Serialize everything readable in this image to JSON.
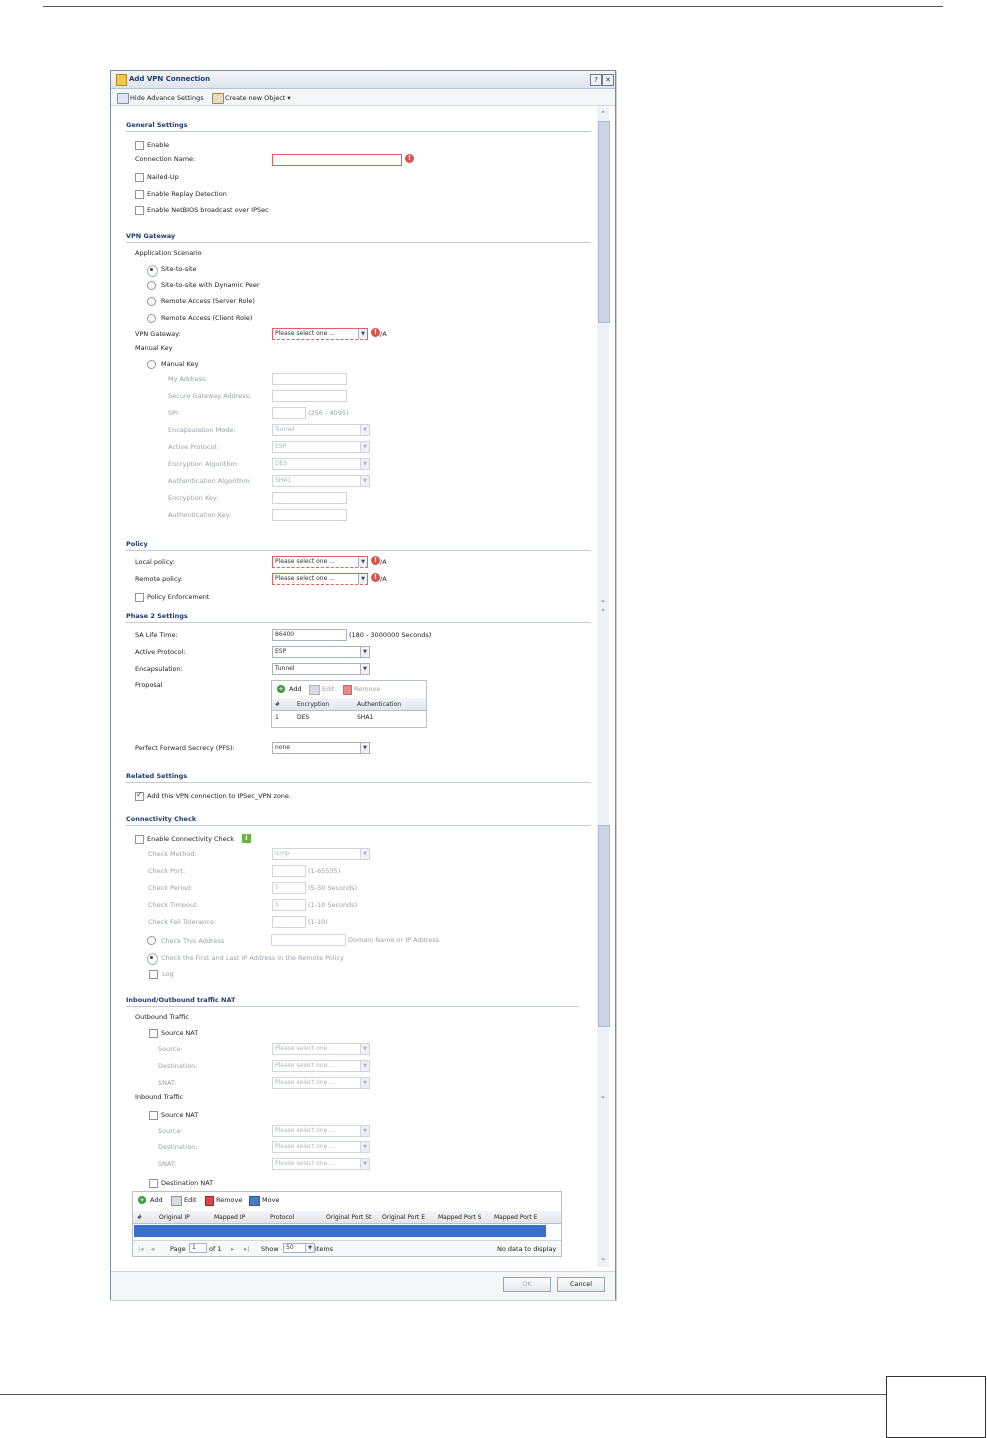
{
  "dialog": {
    "title": "Add VPN Connection",
    "help_glyph": "?",
    "close_glyph": "✕",
    "toolbar": {
      "hide_advanced": "Hide Advance Settings",
      "create_object": "Create new Object ▾"
    }
  },
  "general": {
    "title": "General Settings",
    "enable": "Enable",
    "connection_name_label": "Connection Name:",
    "connection_name_value": "",
    "nailed_up": "Nailed-Up",
    "replay_detection": "Enable Replay Detection",
    "netbios": "Enable NetBIOS broadcast over IPSec"
  },
  "gateway": {
    "title": "VPN Gateway",
    "scenario_label": "Application Scenario",
    "scenarios": [
      "Site-to-site",
      "Site-to-site with Dynamic Peer",
      "Remote Access (Server Role)",
      "Remote Access (Client Role)"
    ],
    "gateway_label": "VPN Gateway:",
    "gateway_value": "Please select one ...",
    "na": "/A",
    "manual_key_heading": "Manual Key",
    "manual_key_radio": "Manual Key",
    "my_address": "My Address:",
    "secure_gateway": "Secure Gateway Address:",
    "spi": "SPI:",
    "spi_range": "(256 - 4095)",
    "encap_mode": "Encapsulation Mode:",
    "encap_mode_value": "Tunnel",
    "active_protocol": "Active Protocol:",
    "active_protocol_value": "ESP",
    "enc_algo": "Encryption Algorithm:",
    "enc_algo_value": "DES",
    "auth_algo": "Authentication Algorithm:",
    "auth_algo_value": "SHA1",
    "enc_key": "Encryption Key:",
    "auth_key": "Authentication Key:"
  },
  "policy": {
    "title": "Policy",
    "local_label": "Local policy:",
    "local_value": "Please select one ...",
    "remote_label": "Remote policy:",
    "remote_value": "Please select one ...",
    "na": "/A",
    "enforcement": "Policy Enforcement"
  },
  "phase2": {
    "title": "Phase 2 Settings",
    "sa_life_label": "SA Life Time:",
    "sa_life_value": "86400",
    "sa_life_range": "(180 - 3000000 Seconds)",
    "active_protocol_label": "Active Protocol:",
    "active_protocol_value": "ESP",
    "encapsulation_label": "Encapsulation:",
    "encapsulation_value": "Tunnel",
    "proposal_label": "Proposal",
    "add": "Add",
    "edit": "Edit",
    "remove": "Remove",
    "columns": [
      "#",
      "Encryption",
      "Authentication"
    ],
    "rows": [
      [
        "1",
        "DES",
        "SHA1"
      ]
    ],
    "pfs_label": "Perfect Forward Secrecy (PFS):",
    "pfs_value": "none"
  },
  "related": {
    "title": "Related Settings",
    "add_zone": "Add this VPN connection to IPSec_VPN zone."
  },
  "connectivity": {
    "title": "Connectivity Check",
    "enable": "Enable Connectivity Check",
    "method_label": "Check Method:",
    "method_value": "icmp",
    "port_label": "Check Port:",
    "port_range": "(1-65535)",
    "period_label": "Check Period:",
    "period_value": "5",
    "period_range": "(5-30 Seconds)",
    "timeout_label": "Check Timeout:",
    "timeout_value": "5",
    "timeout_range": "(1-10 Seconds)",
    "fail_label": "Check Fail Tolerance:",
    "fail_range": "(1-10)",
    "this_address": "Check This Address",
    "domain_hint": "Domain Name or IP Address",
    "first_last": "Check the First and Last IP Address in the Remote Policy",
    "log": "Log"
  },
  "nat": {
    "title": "Inbound/Outbound traffic NAT",
    "outbound": "Outbound Traffic",
    "inbound": "Inbound Traffic",
    "source_nat": "Source NAT",
    "source": "Source:",
    "destination": "Destination:",
    "snat": "SNAT:",
    "placeholder": "Please select one ...",
    "destination_nat": "Destination NAT",
    "add": "Add",
    "edit": "Edit",
    "remove": "Remove",
    "move": "Move",
    "columns": [
      "#",
      "Original IP",
      "Mapped IP",
      "Protocol",
      "Original Port St",
      "Original Port E",
      "Mapped Port S",
      "Mapped Port E"
    ],
    "pager_page": "Page",
    "pager_page_value": "1",
    "pager_of": "of 1",
    "pager_show": "Show",
    "pager_show_value": "50",
    "pager_items": "items",
    "no_data": "No data to display"
  },
  "footer": {
    "ok": "OK",
    "cancel": "Cancel"
  }
}
